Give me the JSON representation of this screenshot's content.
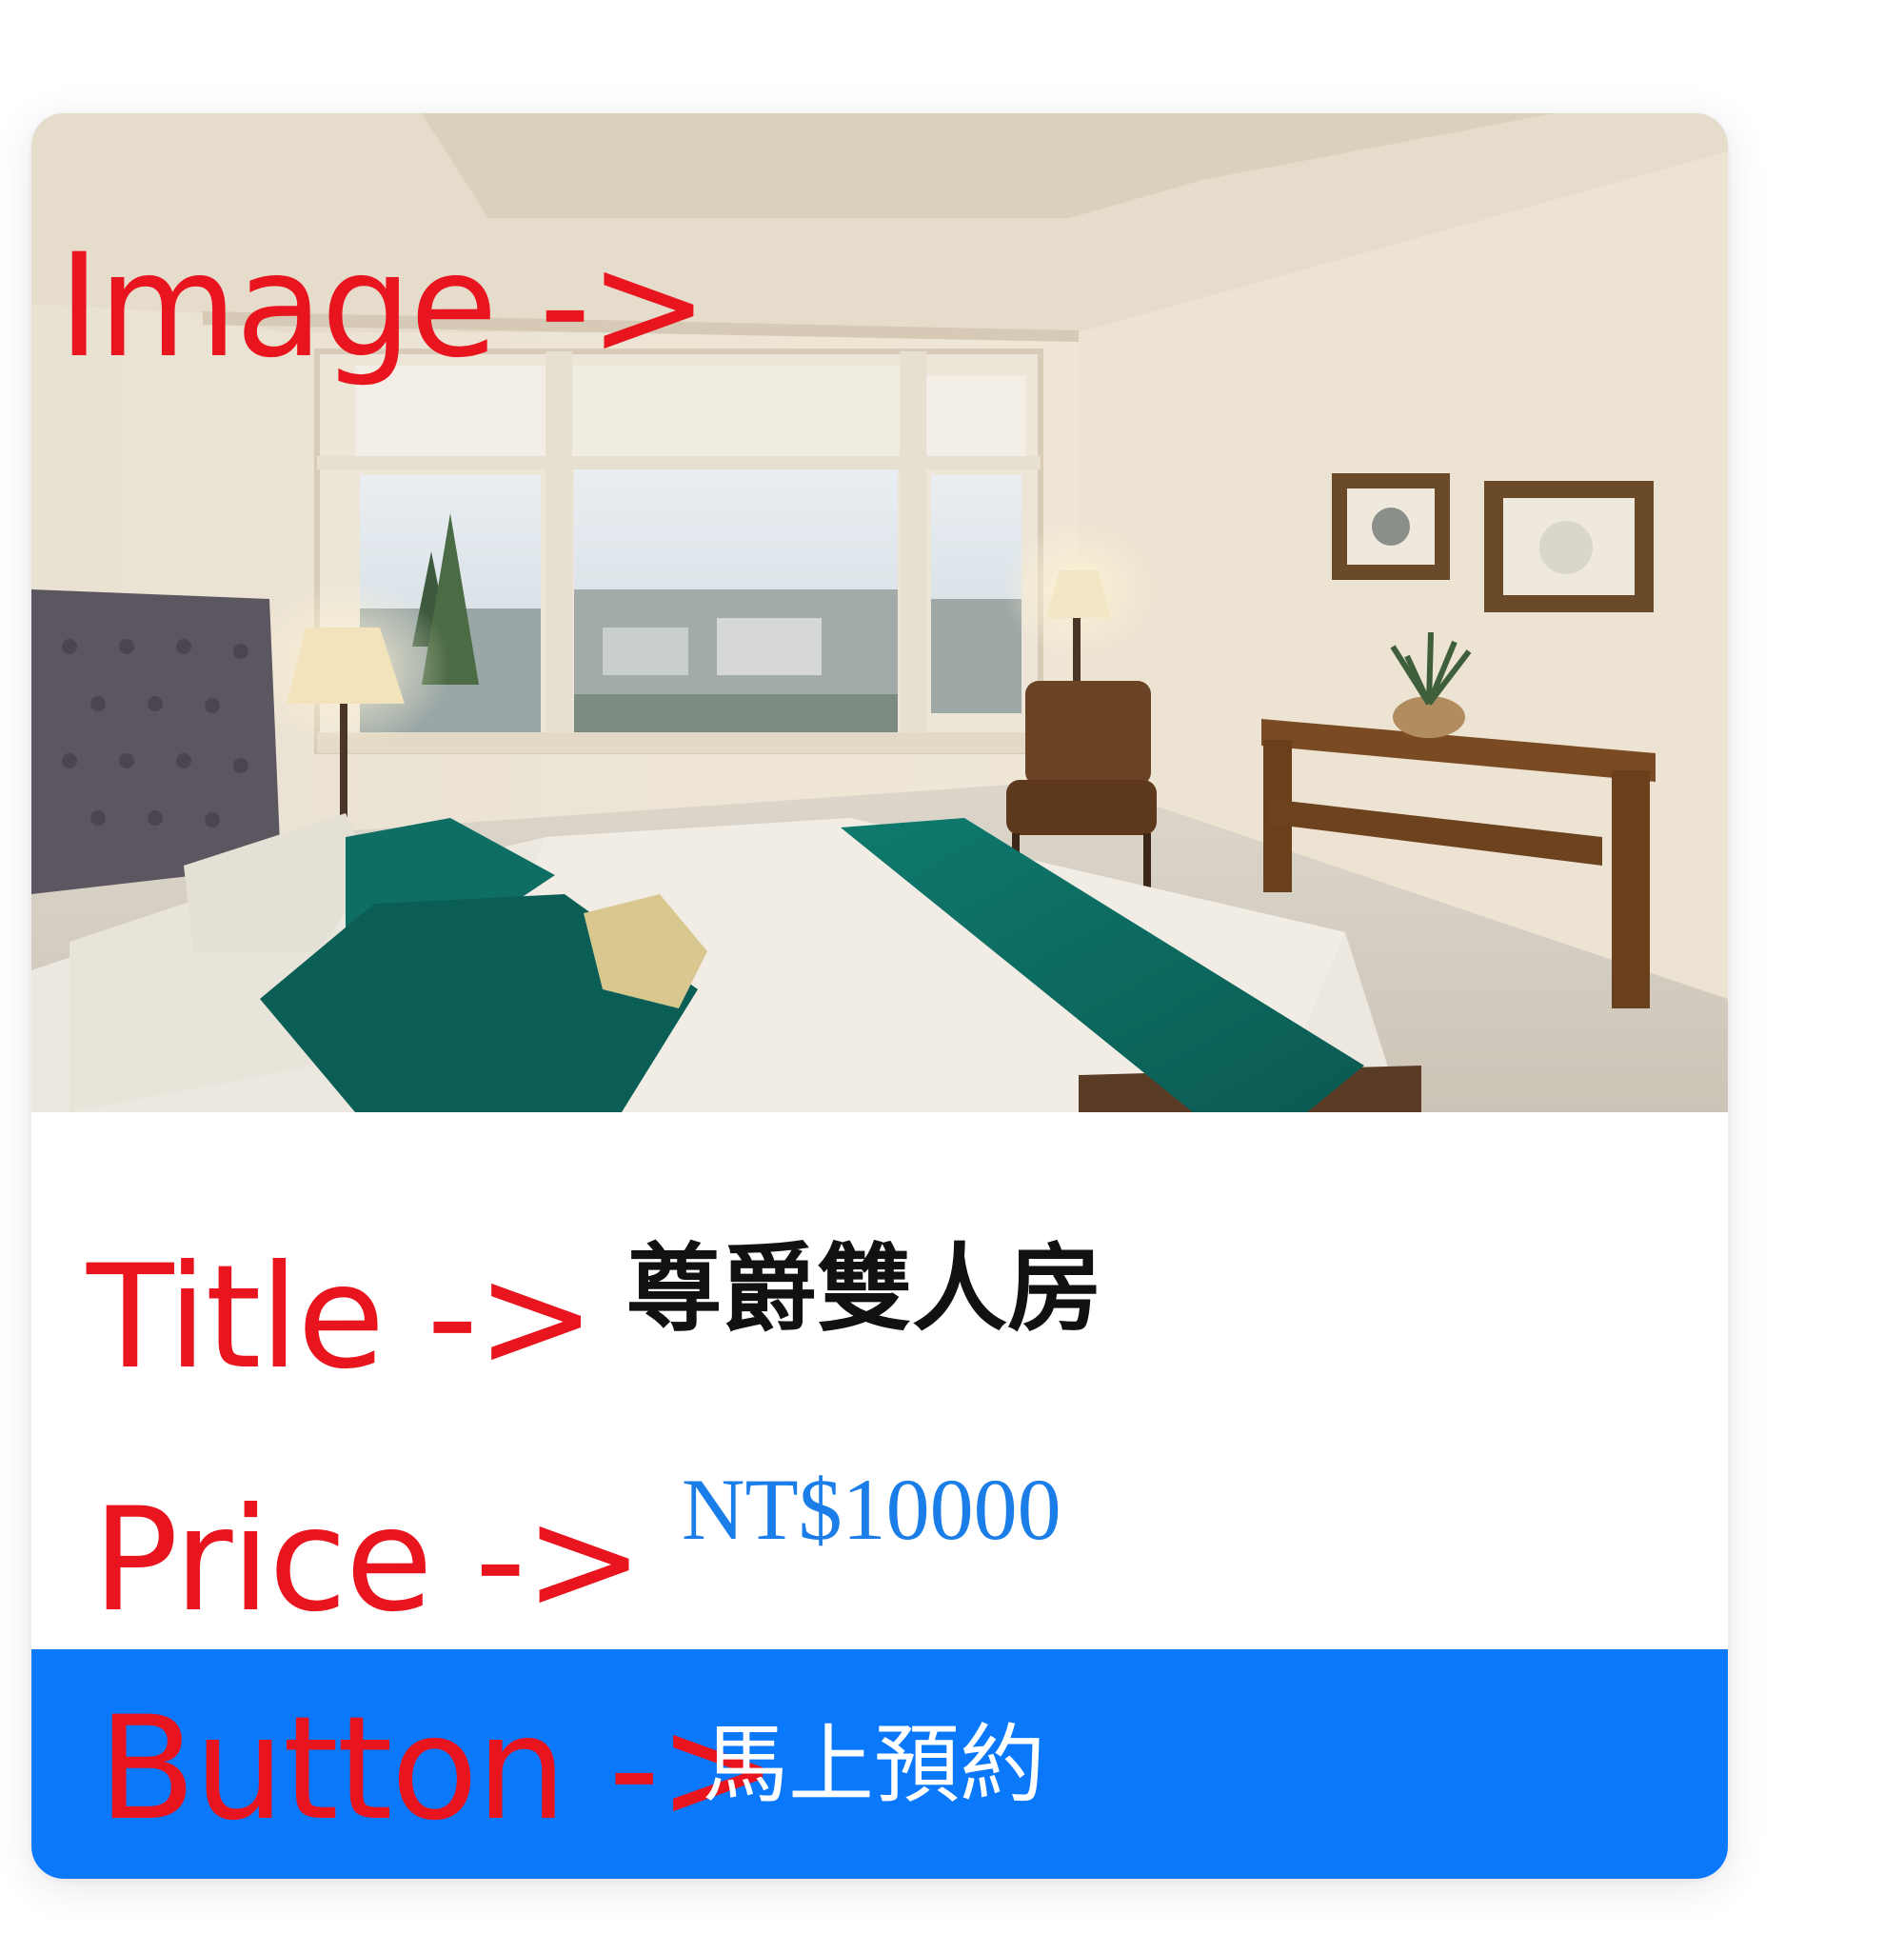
{
  "card": {
    "image_alt": "Bedroom photo",
    "title": "尊爵雙人房",
    "price": "NT$10000",
    "button_label": "馬上預約"
  },
  "annotations": {
    "image": "Image ->",
    "title": "Title ->",
    "price": "Price ->",
    "button": "Button ->"
  },
  "colors": {
    "annotation": "#e8141e",
    "price": "#1a7de8",
    "button_bg": "#0a78fb",
    "button_text": "#ffffff",
    "title": "#111111"
  }
}
